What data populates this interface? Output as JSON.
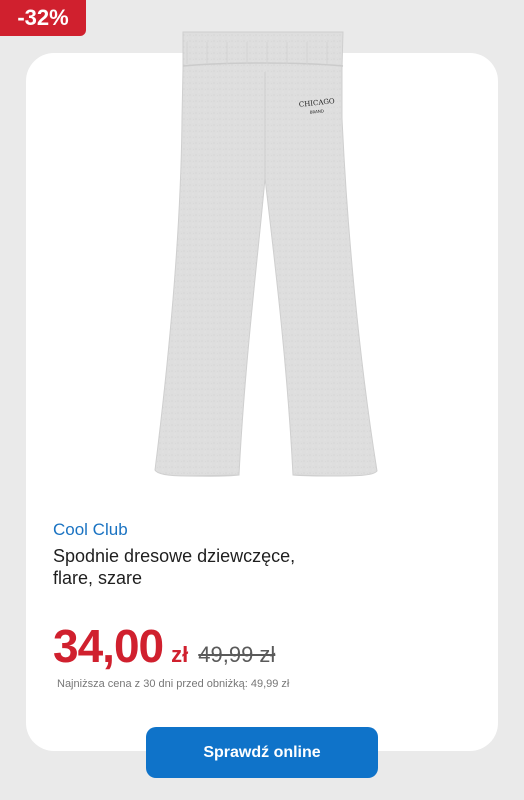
{
  "badge": {
    "discount": "-32%"
  },
  "product": {
    "brand": "Cool Club",
    "name": "Spodnie dresowe dziewczęce, flare, szare",
    "image_print_text": "CHICAGO",
    "image_print_subtext": "BRAND"
  },
  "price": {
    "current": "34,00",
    "currency": "zł",
    "old": "49,99 zł",
    "lowest_note": "Najniższa cena z 30 dni przed obniżką: 49,99 zł"
  },
  "cta": {
    "label": "Sprawdź online"
  },
  "colors": {
    "accent_red": "#d0202e",
    "brand_blue": "#1a73c2",
    "button_blue": "#0f73c9",
    "background": "#eaeaea",
    "card": "#ffffff"
  }
}
